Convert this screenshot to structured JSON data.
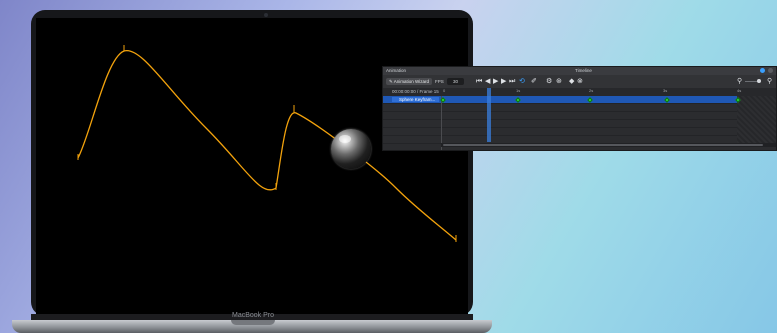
{
  "device": {
    "brand_label": "MacBook Pro"
  },
  "viewport": {
    "background_color": "#000000",
    "curve_color": "#f2a20c",
    "object": "sphere"
  },
  "timeline_panel": {
    "left_title": "Animation",
    "title": "Timeline",
    "toolbar": {
      "animation_wizard_label": "Animation Wizard",
      "fps_label": "FPS",
      "fps_value": "30"
    },
    "time_display": "00:00:00:00 / Frame 15",
    "ruler_labels": [
      "0",
      "1s",
      "2s",
      "3s",
      "4s"
    ],
    "tracks": [
      {
        "name": "Sphere Keyfram..."
      }
    ],
    "keyframe_color": "#2ddb3a",
    "selected_row_color": "#1f58b5"
  }
}
